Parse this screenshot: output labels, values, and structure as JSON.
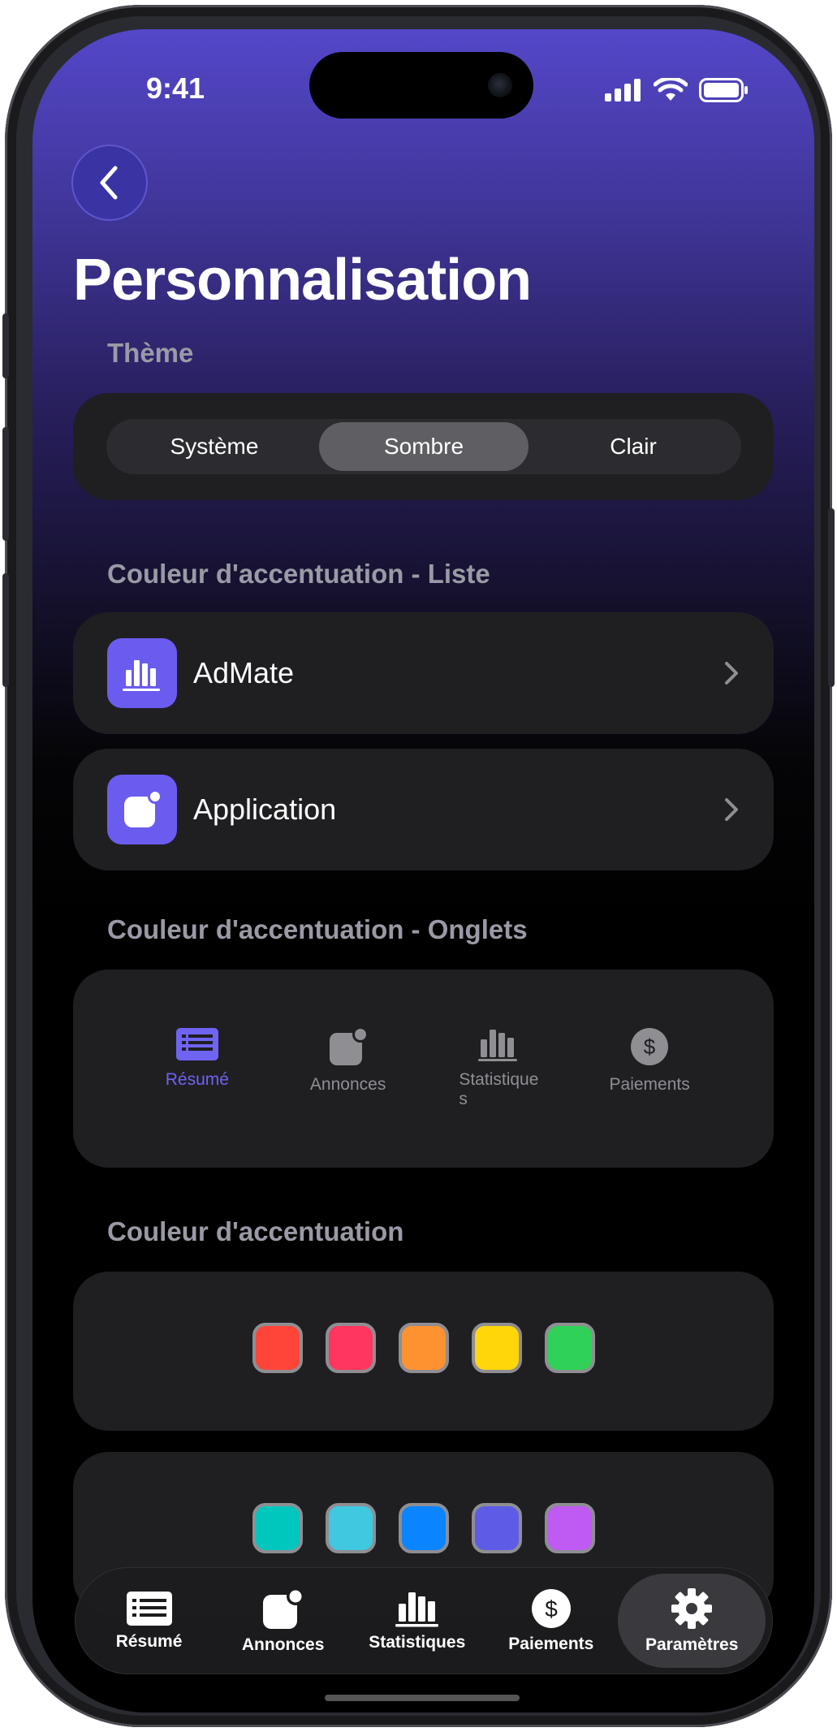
{
  "status": {
    "time": "9:41"
  },
  "page": {
    "title": "Personnalisation"
  },
  "theme": {
    "label": "Thème",
    "options": [
      "Système",
      "Sombre",
      "Clair"
    ],
    "selected": "Sombre"
  },
  "accent_list": {
    "label": "Couleur d'accentuation - Liste",
    "items": [
      {
        "label": "AdMate",
        "icon": "chart-bars-icon"
      },
      {
        "label": "Application",
        "icon": "app-badge-icon"
      }
    ]
  },
  "accent_tabs": {
    "label": "Couleur d'accentuation - Onglets",
    "items": [
      {
        "label": "Résumé",
        "icon": "list-icon",
        "active": true
      },
      {
        "label": "Annonces",
        "icon": "app-badge-icon",
        "active": false
      },
      {
        "label": "Statistique\ns",
        "icon": "chart-bars-icon",
        "active": false
      },
      {
        "label": "Paiements",
        "icon": "dollar-icon",
        "active": false
      }
    ]
  },
  "accent_color": {
    "label": "Couleur d'accentuation",
    "row1": [
      "#ff453a",
      "#ff375f",
      "#ff9230",
      "#ffd60a",
      "#30d158"
    ],
    "row2": [
      "#00c7be",
      "#40c8e0",
      "#0a84ff",
      "#5e5ce6",
      "#bf5af2"
    ]
  },
  "accent": "#6b5cf0",
  "tabbar": {
    "items": [
      {
        "label": "Résumé",
        "icon": "list-icon"
      },
      {
        "label": "Annonces",
        "icon": "app-badge-icon"
      },
      {
        "label": "Statistiques",
        "icon": "chart-bars-icon"
      },
      {
        "label": "Paiements",
        "icon": "dollar-icon"
      },
      {
        "label": "Paramètres",
        "icon": "gear-icon"
      }
    ],
    "selected": "Paramètres"
  }
}
